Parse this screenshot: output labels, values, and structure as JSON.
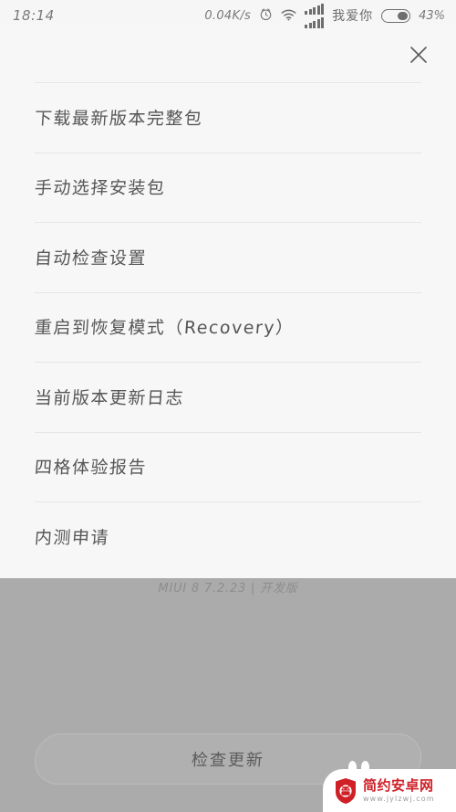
{
  "status_bar": {
    "time": "18:14",
    "net_speed": "0.04K/s",
    "alarm_icon": "alarm-clock-icon",
    "wifi_icon": "wifi-icon",
    "signal_icon": "signal-bars-icon",
    "carrier": "我爱你",
    "battery_icon": "battery-icon",
    "battery_percent": "43%"
  },
  "sheet": {
    "close_icon": "close-icon",
    "items": [
      {
        "label": "下载最新版本完整包",
        "name": "menu-item-download-full-package"
      },
      {
        "label": "手动选择安装包",
        "name": "menu-item-manual-select-package"
      },
      {
        "label": "自动检查设置",
        "name": "menu-item-auto-check-settings"
      },
      {
        "label": "重启到恢复模式（Recovery）",
        "name": "menu-item-reboot-recovery"
      },
      {
        "label": "当前版本更新日志",
        "name": "menu-item-changelog"
      },
      {
        "label": "四格体验报告",
        "name": "menu-item-experience-report"
      },
      {
        "label": "内测申请",
        "name": "menu-item-beta-application"
      }
    ]
  },
  "background": {
    "version_line": "MIUI 8 7.2.23 | 开发版",
    "check_update_label": "检查更新"
  },
  "watermark": {
    "title": "简约安卓网",
    "url": "www.jylzwj.com",
    "logo_icon": "android-shield-logo-icon"
  },
  "colors": {
    "sheet_bg": "#f7f7f7",
    "dim_bg": "#ababab",
    "text": "#565656",
    "divider": "#e6e6e6",
    "watermark_red": "#cf2027"
  }
}
